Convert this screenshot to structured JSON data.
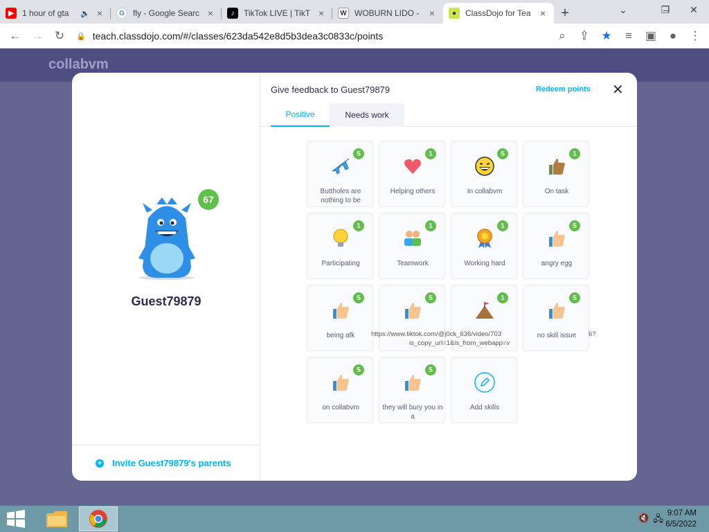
{
  "browser": {
    "tabs": [
      {
        "title": "1 hour of gta",
        "icon": "youtube-icon",
        "muted": true
      },
      {
        "title": "fly - Google Searc",
        "icon": "google-icon",
        "muted": false
      },
      {
        "title": "TikTok LIVE | TikT",
        "icon": "tiktok-icon",
        "muted": false
      },
      {
        "title": "WOBURN LIDO -",
        "icon": "woburn-icon",
        "muted": false
      },
      {
        "title": "ClassDojo for Tea",
        "icon": "classdojo-icon",
        "muted": false,
        "active": true
      }
    ],
    "url": "teach.classdojo.com/#/classes/623da542e8d5b3dea3c0833c/points"
  },
  "background": {
    "logo": "collabvm"
  },
  "modal": {
    "student_name": "Guest79879",
    "student_points": "67",
    "invite_parents": "Invite Guest79879's parents",
    "title": "Give feedback to Guest79879",
    "redeem": "Redeem points",
    "tabs": {
      "positive": "Positive",
      "needs_work": "Needs work"
    },
    "skills": [
      {
        "label": "Buttholes are nothing to be",
        "points": "5",
        "icon": "airplane-icon"
      },
      {
        "label": "Helping others",
        "points": "1",
        "icon": "heart-icon"
      },
      {
        "label": "In collabvm",
        "points": "5",
        "icon": "laughing-face-icon"
      },
      {
        "label": "On task",
        "points": "1",
        "icon": "thumbs-up-icon"
      },
      {
        "label": "Participating",
        "points": "1",
        "icon": "lightbulb-icon"
      },
      {
        "label": "Teamwork",
        "points": "1",
        "icon": "team-icon"
      },
      {
        "label": "Working hard",
        "points": "1",
        "icon": "medal-icon"
      },
      {
        "label": "angry egg",
        "points": "5",
        "icon": "thumbs-up-icon"
      },
      {
        "label": "being afk",
        "points": "5",
        "icon": "thumbs-up-icon"
      },
      {
        "label": "",
        "points": "5",
        "icon": "thumbs-up-icon"
      },
      {
        "label": "",
        "points": "1",
        "icon": "mountain-flag-icon"
      },
      {
        "label": "no skill issue",
        "points": "5",
        "icon": "thumbs-up-icon"
      },
      {
        "label": "on collabvm",
        "points": "5",
        "icon": "thumbs-up-icon"
      },
      {
        "label": "they will bury you in a",
        "points": "5",
        "icon": "thumbs-up-icon"
      },
      {
        "label": "Add skills",
        "points": "",
        "icon": "pencil-icon"
      }
    ],
    "overflow_text_line1": "https://www.tiktok.com/@j0ck_636/video/703",
    "overflow_text_line2": "is_copy_url=1&is_from_webapp=v",
    "overflow_text_tail": "6?"
  },
  "taskbar": {
    "time": "9:07 AM",
    "date": "6/5/2022"
  }
}
